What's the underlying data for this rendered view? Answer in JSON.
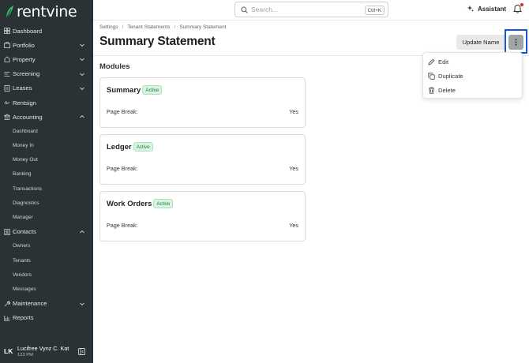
{
  "app": {
    "brand": "rentvine",
    "colors": {
      "sidebar_bg": "#2a3235",
      "brand_green": "#2fc26b",
      "accent_blue": "#1456cf",
      "badge_green_bg": "#d9f5e1"
    }
  },
  "sidebar": {
    "items": [
      {
        "label": "Dashboard",
        "icon": "dashboard-icon"
      },
      {
        "label": "Portfolio",
        "icon": "portfolio-icon",
        "expandable": true
      },
      {
        "label": "Property",
        "icon": "property-icon",
        "expandable": true
      },
      {
        "label": "Screening",
        "icon": "screening-icon",
        "expandable": true
      },
      {
        "label": "Leases",
        "icon": "leases-icon",
        "expandable": true
      },
      {
        "label": "Rentsign",
        "icon": "rentsign-icon"
      },
      {
        "label": "Accounting",
        "icon": "accounting-icon",
        "expanded": true
      }
    ],
    "accounting_subitems": [
      "Dashboard",
      "Money In",
      "Money Out",
      "Banking",
      "Transactions",
      "Diagnostics",
      "Manager"
    ],
    "contacts": {
      "label": "Contacts",
      "icon": "contacts-icon",
      "expanded": true
    },
    "contacts_subitems": [
      "Owners",
      "Tenants",
      "Vendors",
      "Messages"
    ],
    "maintenance": {
      "label": "Maintenance",
      "icon": "wrench-icon"
    },
    "reports": {
      "label": "Reports",
      "icon": "chart-icon"
    },
    "user": {
      "initials": "LK",
      "name": "Lucifree Vynz C. Kat",
      "subtitle": "123 PM"
    }
  },
  "topbar": {
    "search_placeholder": "Search...",
    "shortcut": "Ctrl+K",
    "assistant_label": "Assistant"
  },
  "header": {
    "breadcrumb": [
      "Settings",
      "Tenant Statements",
      "Summary Statement"
    ],
    "title": "Summary Statement",
    "update_button": "Update Name"
  },
  "menu": {
    "items": [
      {
        "label": "Edit",
        "icon": "pencil-icon"
      },
      {
        "label": "Duplicate",
        "icon": "copy-icon"
      },
      {
        "label": "Delete",
        "icon": "trash-icon"
      }
    ]
  },
  "modules": {
    "title": "Modules",
    "cards": [
      {
        "name": "Summary",
        "badge": "Active",
        "field_label": "Page Break:",
        "field_value": "Yes"
      },
      {
        "name": "Ledger",
        "badge": "Active",
        "field_label": "Page Break:",
        "field_value": "Yes"
      },
      {
        "name": "Work Orders",
        "badge": "Active",
        "field_label": "Page Break:",
        "field_value": "Yes"
      }
    ]
  }
}
